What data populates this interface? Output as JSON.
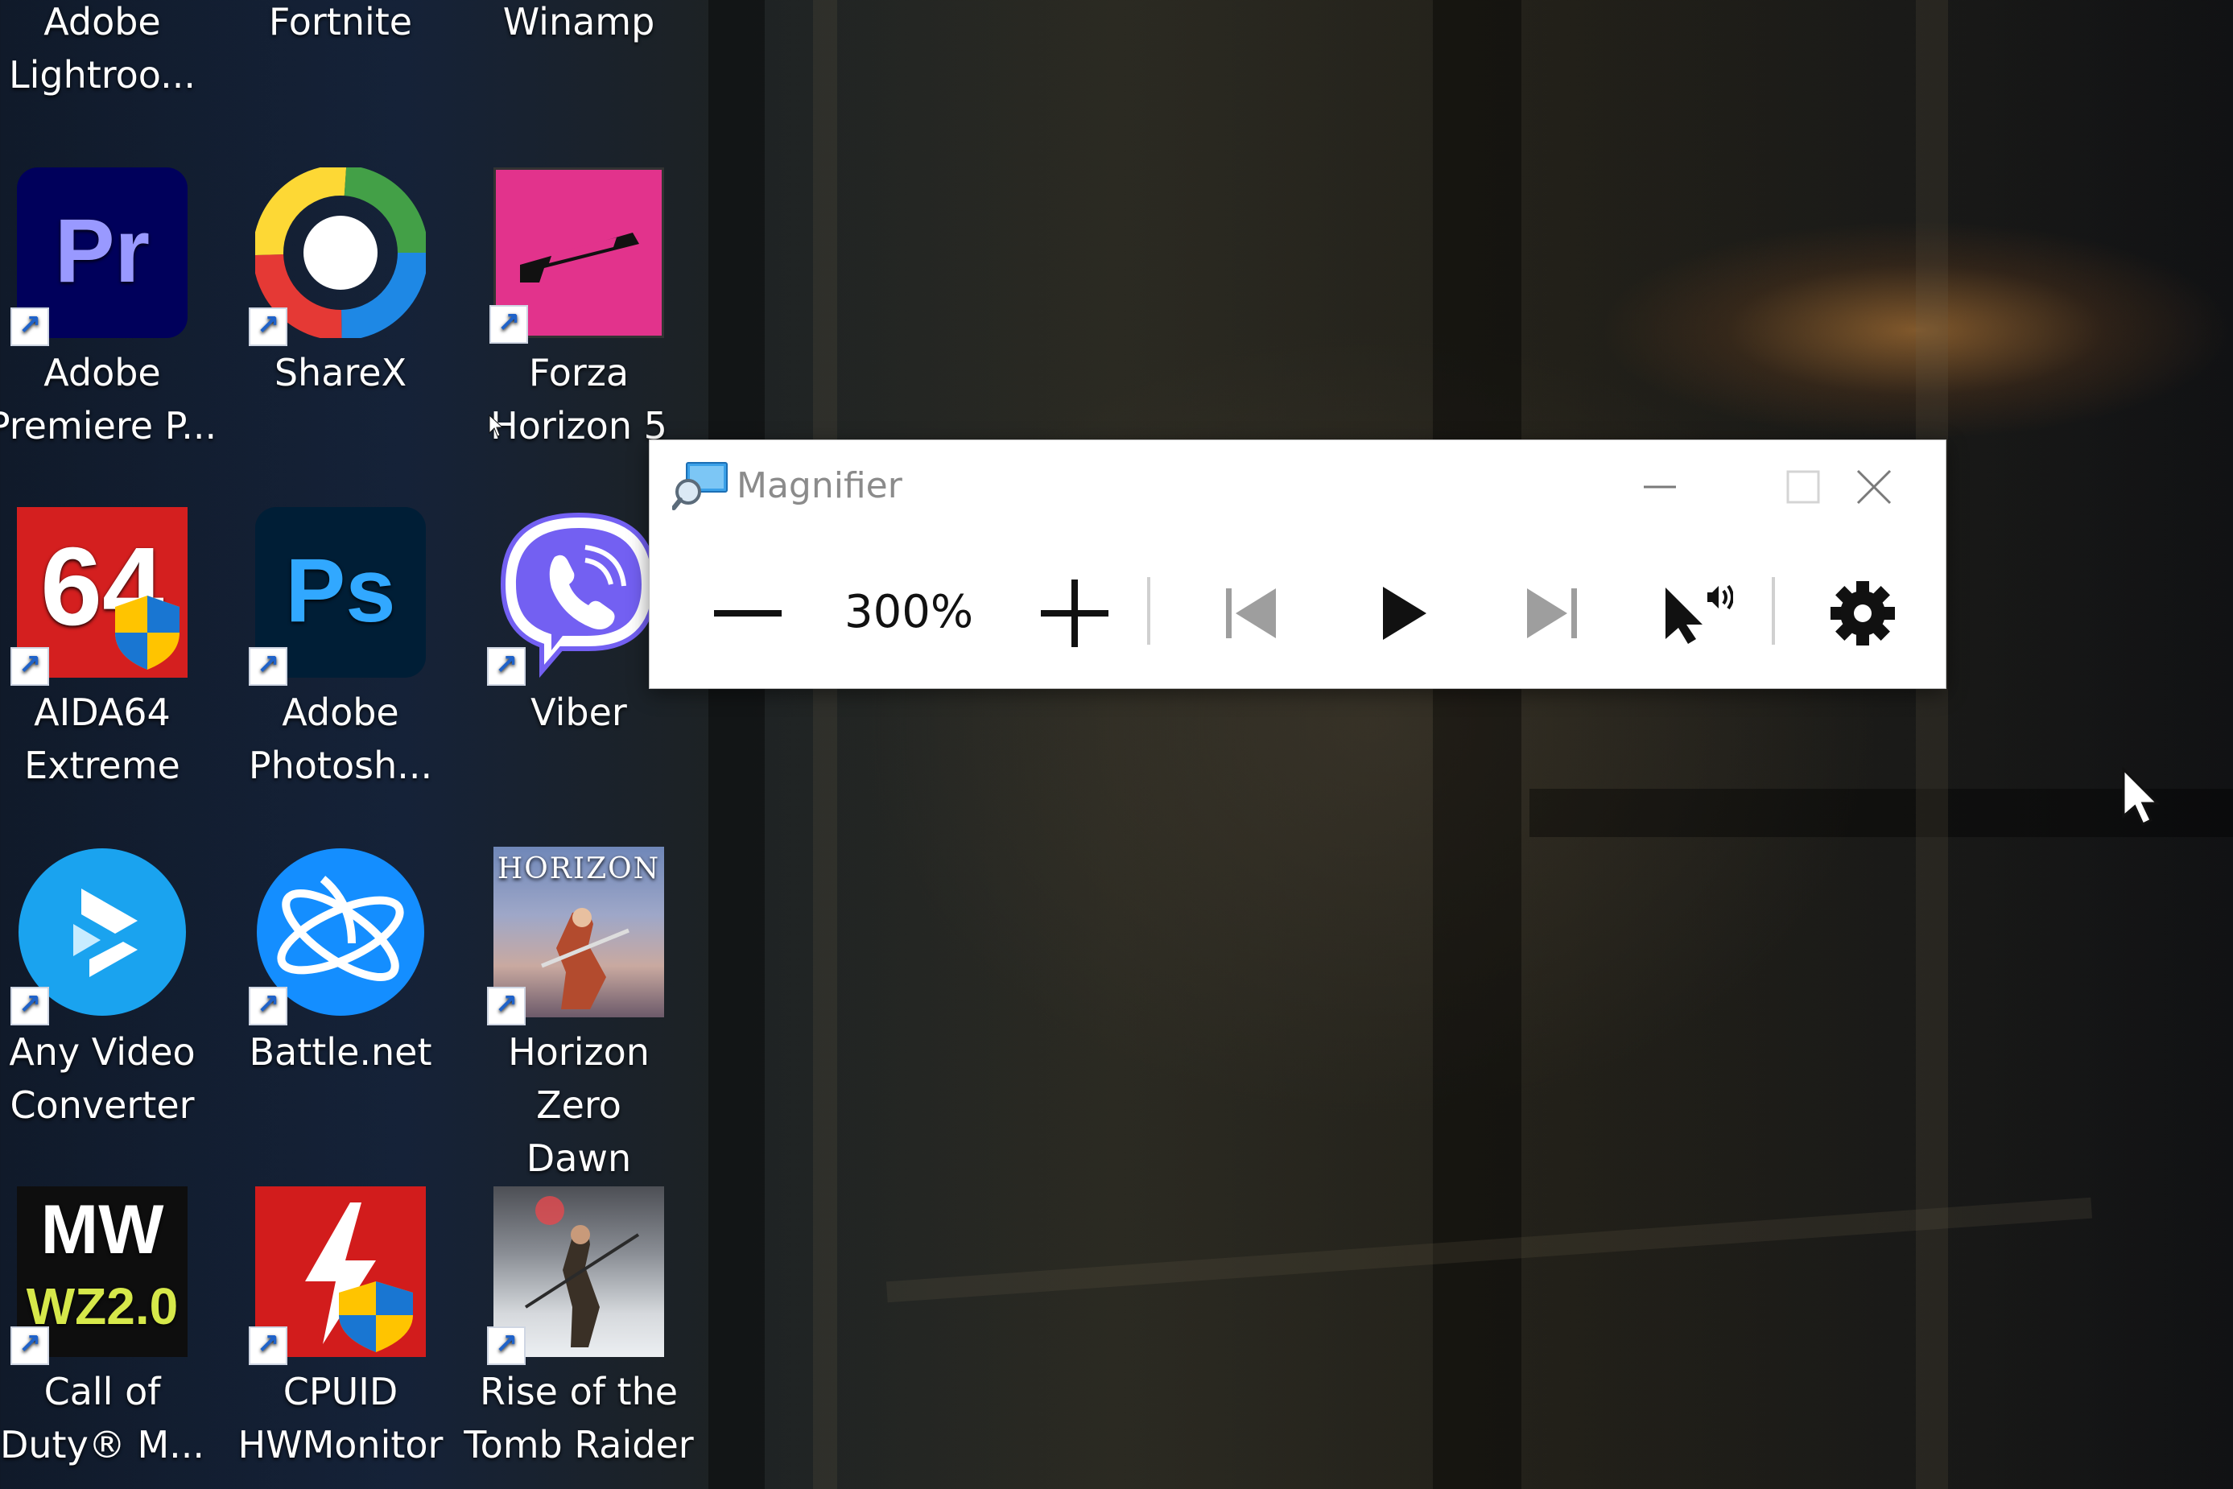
{
  "desktop": {
    "icons": [
      {
        "label": "Adobe\nLightroo...",
        "icon": "lightroom-icon"
      },
      {
        "label": "Fortnite",
        "icon": "fortnite-icon"
      },
      {
        "label": "Winamp",
        "icon": "winamp-icon"
      },
      {
        "label": "Adobe\nPremiere P...",
        "icon": "premiere-pro-icon",
        "glyph": "Pr"
      },
      {
        "label": "ShareX",
        "icon": "sharex-icon"
      },
      {
        "label": "Forza\nHorizon 5",
        "icon": "forza-horizon-icon"
      },
      {
        "label": "AIDA64\nExtreme",
        "icon": "aida64-icon",
        "glyph": "64"
      },
      {
        "label": "Adobe\nPhotosh...",
        "icon": "photoshop-icon",
        "glyph": "Ps"
      },
      {
        "label": "Viber",
        "icon": "viber-icon"
      },
      {
        "label": "Any Video\nConverter",
        "icon": "any-video-converter-icon"
      },
      {
        "label": "Battle.net",
        "icon": "battlenet-icon"
      },
      {
        "label": "Horizon Zero\nDawn Com...",
        "icon": "horizon-zero-dawn-icon",
        "glyph": "HORIZON"
      },
      {
        "label": "Call of\nDuty® M...",
        "icon": "call-of-duty-icon",
        "glyph": "MW",
        "glyph2": "WZ2.0"
      },
      {
        "label": "CPUID\nHWMonitor",
        "icon": "hwmonitor-icon"
      },
      {
        "label": "Rise of the\nTomb Raider",
        "icon": "tomb-raider-icon"
      }
    ]
  },
  "magnifier": {
    "title": "Magnifier",
    "zoom": "300%",
    "icons": {
      "app": "magnifier-icon",
      "minimize": "minimize-icon",
      "maximize": "maximize-icon",
      "close": "close-icon",
      "zoom_out": "minus-icon",
      "zoom_in": "plus-icon",
      "previous": "skip-previous-icon",
      "play": "play-icon",
      "next": "skip-next-icon",
      "read_from_pointer": "read-from-pointer-icon",
      "settings": "gear-icon"
    }
  },
  "colors": {
    "premiere": "#00005b",
    "premiere_text": "#9999ff",
    "photoshop": "#001e36",
    "photoshop_text": "#31a8ff",
    "forza": "#e2338c",
    "aida": "#d41f1f",
    "viber": "#7360f2",
    "battlenet": "#148eff",
    "anyvideo": "#1aa3ef",
    "hwmonitor": "#d21c1c"
  }
}
